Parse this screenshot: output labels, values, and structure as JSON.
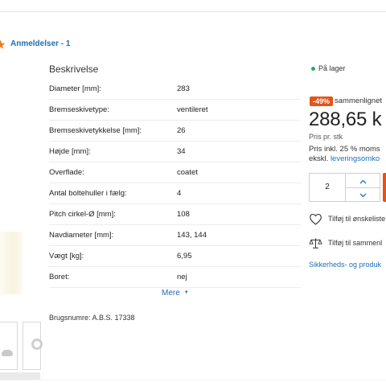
{
  "reviews": {
    "label": "Anmeldelser - 1"
  },
  "description": {
    "title": "Beskrivelse",
    "specs": [
      {
        "label": "Diameter [mm]:",
        "value": "283"
      },
      {
        "label": "Bremseskivetype:",
        "value": "ventileret"
      },
      {
        "label": "Bremseskivetykkelse [mm]:",
        "value": "26"
      },
      {
        "label": "Højde [mm]:",
        "value": "34"
      },
      {
        "label": "Overflade:",
        "value": "coatet"
      },
      {
        "label": "Antal boltehuller i fælg:",
        "value": "4"
      },
      {
        "label": "Pitch cirkel-Ø [mm]:",
        "value": "108"
      },
      {
        "label": "Navdiameter [mm]:",
        "value": "143, 144"
      },
      {
        "label": "Vægt [kg]:",
        "value": "6,95"
      },
      {
        "label": "Boret:",
        "value": "nej"
      }
    ],
    "more_label": "Mere",
    "usage_numbers": "Brugsnumre: A.B.S. 17338"
  },
  "buybox": {
    "stock_status": "På lager",
    "discount_badge": "-49%",
    "compare_text": "sammenlignet",
    "price": "288,65 k",
    "per_unit": "Pris pr. stk",
    "incl_vat": "Pris inkl. 25 % moms",
    "excl_prefix": "ekskl.",
    "excl_link": "leveringsomko",
    "quantity": "2",
    "wishlist_label": "Tilføj til ønskeliste",
    "compare_label": "Tilføj til sammenl",
    "safety_link": "Sikkerheds- og produk"
  },
  "colors": {
    "accent_blue": "#1f6fb5",
    "discount_orange": "#e2541b",
    "in_stock_green": "#2fa85b",
    "star_orange": "#f07a1e"
  }
}
